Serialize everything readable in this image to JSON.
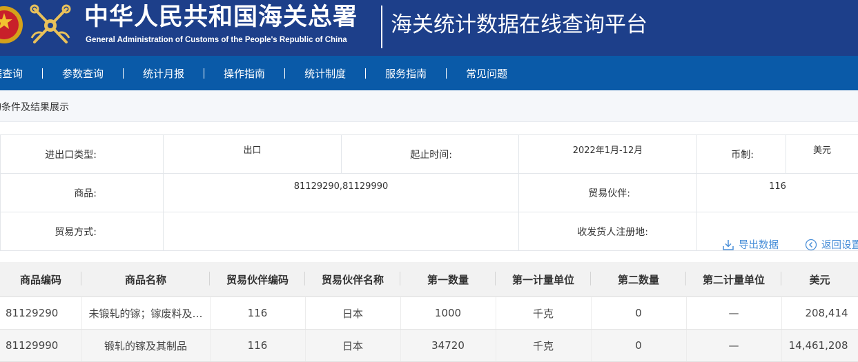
{
  "header": {
    "org_name_cn": "中华人民共和国海关总署",
    "org_name_en": "General Administration of Customs of the People's Republic of China",
    "platform_title": "海关统计数据在线查询平台"
  },
  "nav": {
    "items": [
      "据查询",
      "参数查询",
      "统计月报",
      "操作指南",
      "统计制度",
      "服务指南",
      "常见问题"
    ]
  },
  "section_title": "询条件及结果展示",
  "criteria": {
    "trade_type_label": "进出口类型:",
    "trade_type_value": "出口",
    "period_label": "起止时间:",
    "period_value": "2022年1月-12月",
    "currency_label": "币制:",
    "currency_value": "美元",
    "commodity_label": "商品:",
    "commodity_value": "81129290,81129990",
    "partner_label": "贸易伙伴:",
    "partner_value": "116",
    "trade_mode_label": "贸易方式:",
    "trade_mode_value": "",
    "registration_label": "收发货人注册地:",
    "registration_value": ""
  },
  "actions": {
    "export_label": "导出数据",
    "back_label": "返回设置"
  },
  "results": {
    "headers": [
      "商品编码",
      "商品名称",
      "贸易伙伴编码",
      "贸易伙伴名称",
      "第一数量",
      "第一计量单位",
      "第二数量",
      "第二计量单位",
      "美元"
    ],
    "rows": [
      [
        "81129290",
        "未锻轧的镓；镓废料及…",
        "116",
        "日本",
        "1000",
        "千克",
        "0",
        "—",
        "208,414"
      ],
      [
        "81129990",
        "锻轧的镓及其制品",
        "116",
        "日本",
        "34720",
        "千克",
        "0",
        "—",
        "14,461,208"
      ]
    ]
  },
  "colors": {
    "header_bg": "#1d3f8a",
    "nav_bg": "#0a5aa8",
    "link": "#4a8fd8"
  },
  "icons": [
    "national-emblem-icon",
    "customs-emblem-icon",
    "download-icon",
    "back-icon"
  ]
}
